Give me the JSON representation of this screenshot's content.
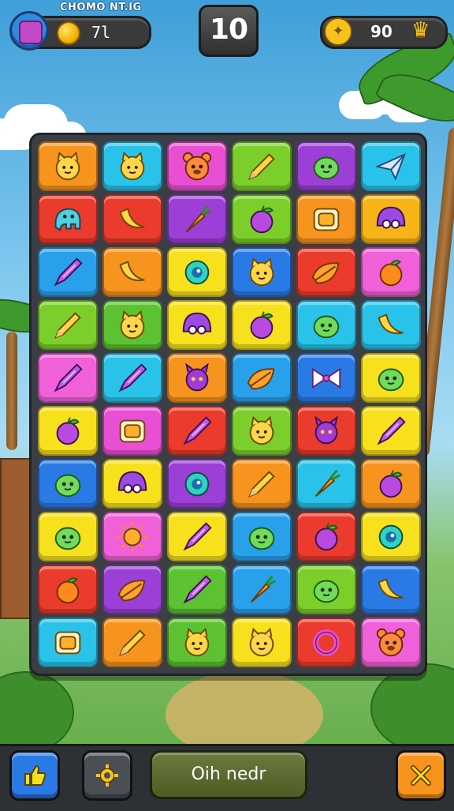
{
  "header": {
    "player_name": "CHOMO NT.IG",
    "coins": "7l",
    "moves": "10",
    "score": "90",
    "icons": [
      "avatar",
      "coin-icon",
      "trophy-icon",
      "crown-icon"
    ]
  },
  "board": {
    "rows": 10,
    "cols": 6,
    "tiles": [
      [
        {
          "c": "#f7941d",
          "i": "cat"
        },
        {
          "c": "#29c3ea",
          "i": "cat"
        },
        {
          "c": "#e94fd3",
          "i": "bear"
        },
        {
          "c": "#7ccf2a",
          "i": "pencil"
        },
        {
          "c": "#9b3fd6",
          "i": "blob"
        },
        {
          "c": "#29c3ea",
          "i": "plane"
        }
      ],
      [
        {
          "c": "#ea3b2c",
          "i": "elephant"
        },
        {
          "c": "#ea3b2c",
          "i": "banana"
        },
        {
          "c": "#9b3fd6",
          "i": "carrot"
        },
        {
          "c": "#7ccf2a",
          "i": "apple"
        },
        {
          "c": "#f7941d",
          "i": "box"
        },
        {
          "c": "#f7b417",
          "i": "helmet"
        }
      ],
      [
        {
          "c": "#29a0ea",
          "i": "crayon"
        },
        {
          "c": "#f7941d",
          "i": "banana"
        },
        {
          "c": "#f7e11d",
          "i": "eye"
        },
        {
          "c": "#2a7ae6",
          "i": "cat"
        },
        {
          "c": "#ea3b2c",
          "i": "leaf"
        },
        {
          "c": "#f060d8",
          "i": "orange"
        }
      ],
      [
        {
          "c": "#7ccf2a",
          "i": "pencil"
        },
        {
          "c": "#5cc232",
          "i": "cat"
        },
        {
          "c": "#f7e11d",
          "i": "helmet"
        },
        {
          "c": "#f7e11d",
          "i": "apple"
        },
        {
          "c": "#29c3ea",
          "i": "blob"
        },
        {
          "c": "#29c3ea",
          "i": "banana"
        }
      ],
      [
        {
          "c": "#f060d8",
          "i": "crayon"
        },
        {
          "c": "#29c3ea",
          "i": "crayon"
        },
        {
          "c": "#f7941d",
          "i": "devil"
        },
        {
          "c": "#29a0ea",
          "i": "leaf"
        },
        {
          "c": "#2a7ae6",
          "i": "bow"
        },
        {
          "c": "#f7e11d",
          "i": "blob"
        }
      ],
      [
        {
          "c": "#f7e11d",
          "i": "apple"
        },
        {
          "c": "#e94fd3",
          "i": "box"
        },
        {
          "c": "#ea3b2c",
          "i": "crayon"
        },
        {
          "c": "#7ccf2a",
          "i": "cat"
        },
        {
          "c": "#ea3b2c",
          "i": "devil"
        },
        {
          "c": "#f7e11d",
          "i": "crayon"
        }
      ],
      [
        {
          "c": "#2a7ae6",
          "i": "blob"
        },
        {
          "c": "#f7e11d",
          "i": "helmet"
        },
        {
          "c": "#9b3fd6",
          "i": "eye"
        },
        {
          "c": "#f7941d",
          "i": "pencil"
        },
        {
          "c": "#29c3ea",
          "i": "carrot"
        },
        {
          "c": "#f7941d",
          "i": "apple"
        }
      ],
      [
        {
          "c": "#f7e11d",
          "i": "blob"
        },
        {
          "c": "#f060d8",
          "i": "sun"
        },
        {
          "c": "#f7e11d",
          "i": "crayon"
        },
        {
          "c": "#29a0ea",
          "i": "blob"
        },
        {
          "c": "#ea3b2c",
          "i": "apple"
        },
        {
          "c": "#f7e11d",
          "i": "eye"
        }
      ],
      [
        {
          "c": "#ea3b2c",
          "i": "orange"
        },
        {
          "c": "#9b3fd6",
          "i": "leaf"
        },
        {
          "c": "#5cc232",
          "i": "crayon"
        },
        {
          "c": "#29a0ea",
          "i": "carrot"
        },
        {
          "c": "#7ccf2a",
          "i": "blob"
        },
        {
          "c": "#2a7ae6",
          "i": "banana"
        }
      ],
      [
        {
          "c": "#29c3ea",
          "i": "box"
        },
        {
          "c": "#f7941d",
          "i": "pencil"
        },
        {
          "c": "#5cc232",
          "i": "cat"
        },
        {
          "c": "#f7e11d",
          "i": "cat"
        },
        {
          "c": "#ea3b2c",
          "i": "ring"
        },
        {
          "c": "#f060d8",
          "i": "bear"
        }
      ]
    ]
  },
  "footer": {
    "main_label": "Oih nedr",
    "icons": [
      "thumbs-icon",
      "gear-icon",
      "close-icon"
    ]
  }
}
